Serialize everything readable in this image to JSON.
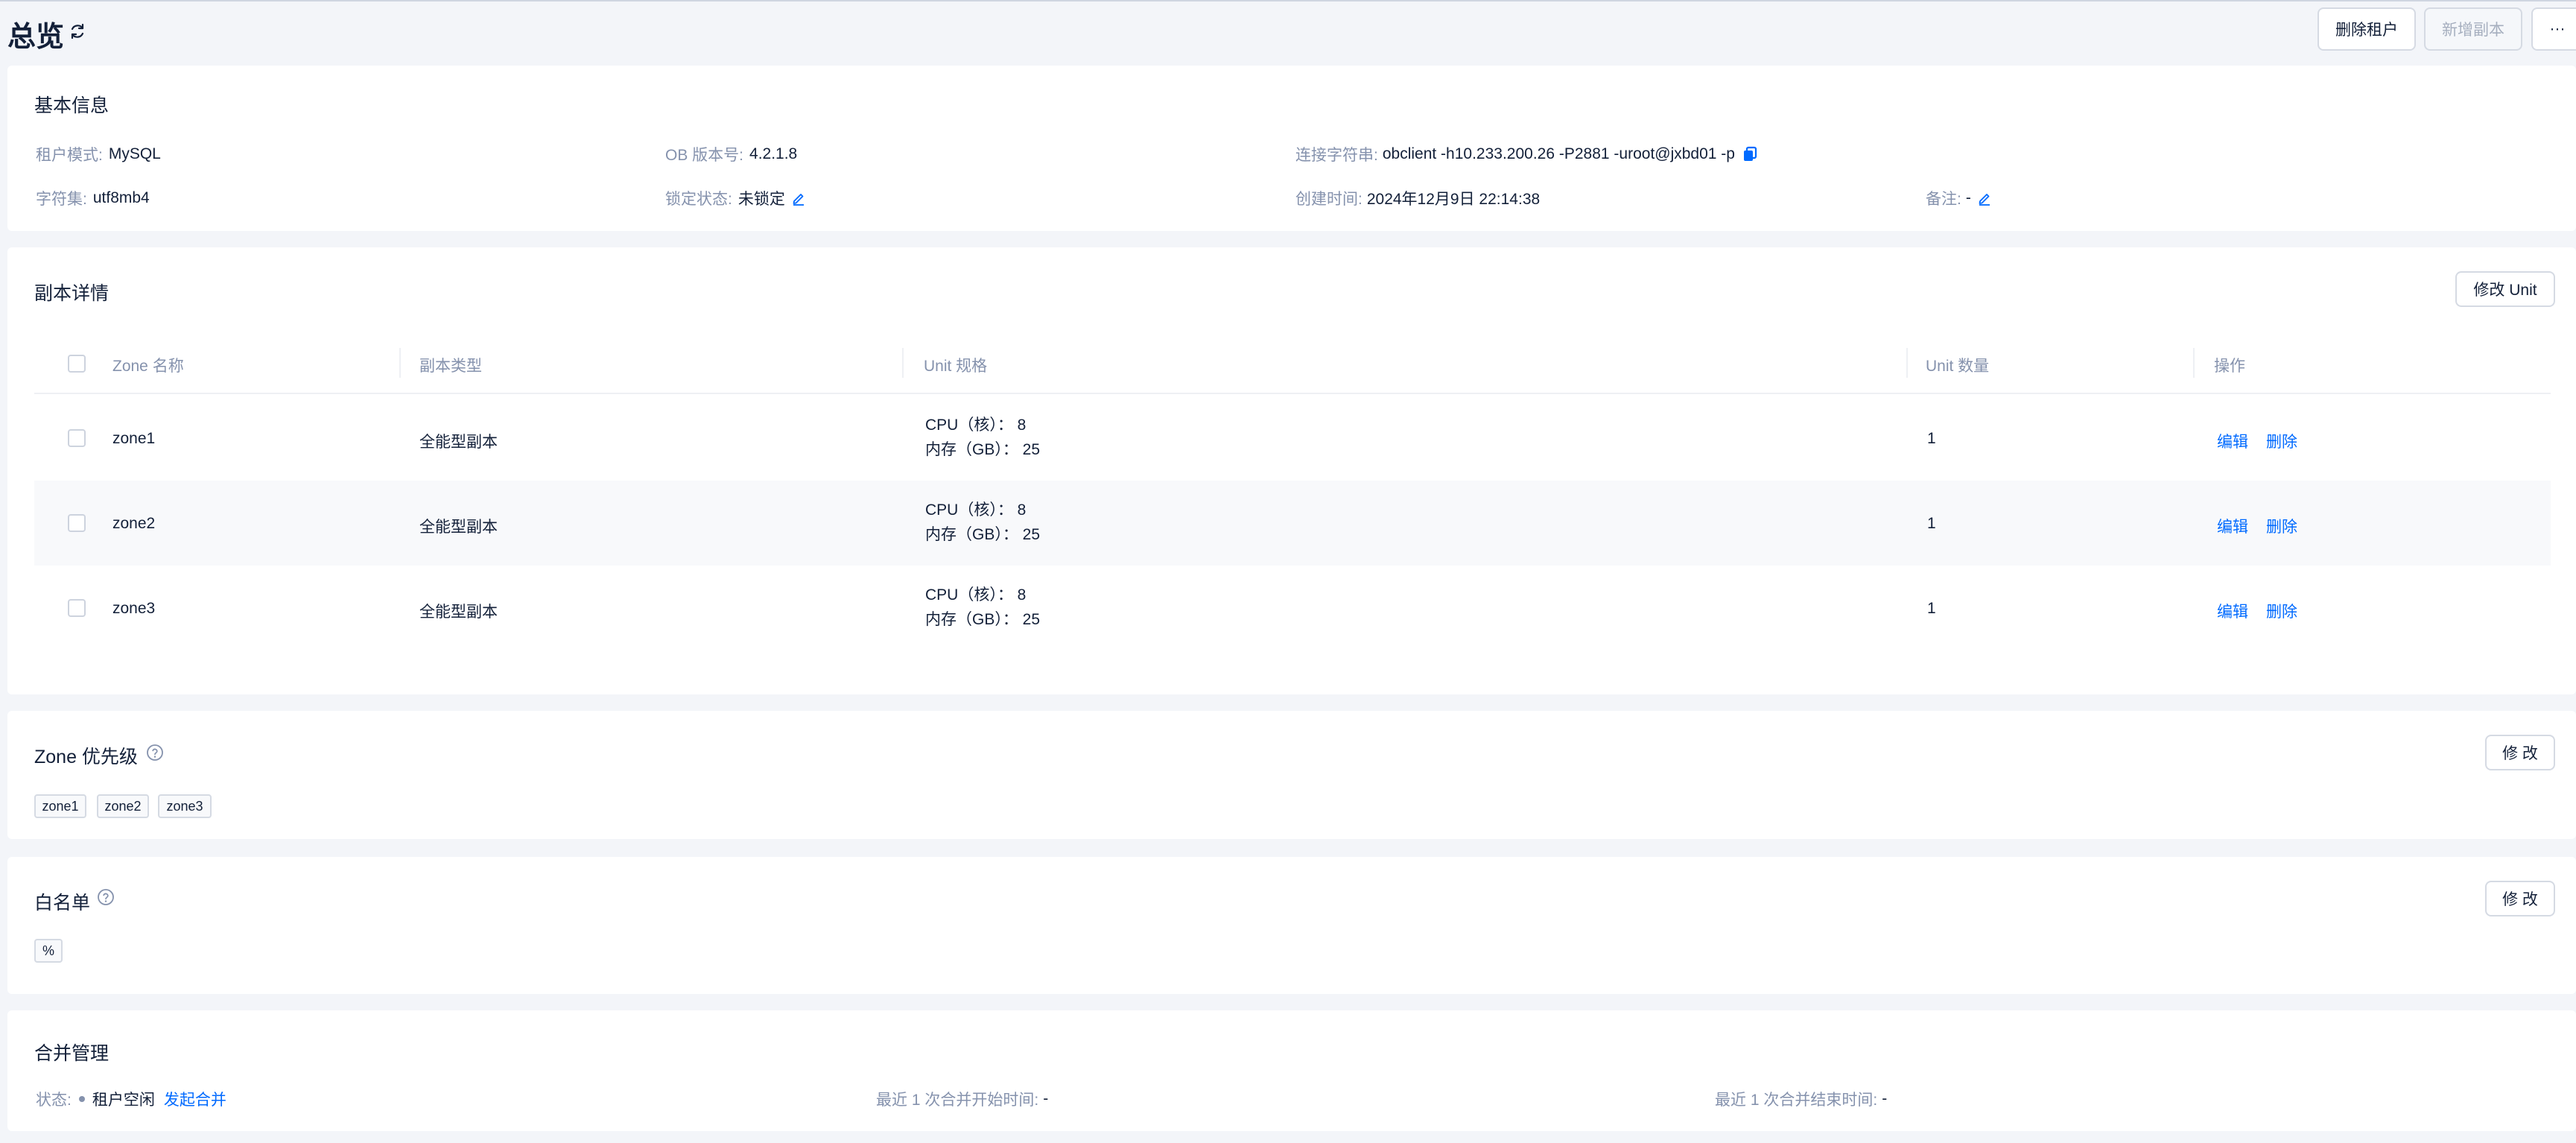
{
  "header": {
    "title": "总览",
    "delete_tenant_label": "删除租户",
    "add_replica_label": "新增副本",
    "more_label": "···"
  },
  "basic_info": {
    "title": "基本信息",
    "tenant_mode_label": "租户模式:",
    "tenant_mode_value": "MySQL",
    "ob_version_label": "OB 版本号:",
    "ob_version_value": "4.2.1.8",
    "conn_string_label": "连接字符串:",
    "conn_string_value": "obclient -h10.233.200.26 -P2881 -uroot@jxbd01 -p",
    "charset_label": "字符集:",
    "charset_value": "utf8mb4",
    "lock_status_label": "锁定状态:",
    "lock_status_value": "未锁定",
    "created_label": "创建时间:",
    "created_value": "2024年12月9日 22:14:38",
    "remark_label": "备注:",
    "remark_value": "-"
  },
  "replicas": {
    "title": "副本详情",
    "modify_unit_label": "修改 Unit",
    "columns": {
      "zone": "Zone 名称",
      "type": "副本类型",
      "unit_spec": "Unit 规格",
      "unit_count": "Unit 数量",
      "actions": "操作"
    },
    "rows": [
      {
        "zone": "zone1",
        "type": "全能型副本",
        "cpu": "CPU（核）： 8",
        "mem": "内存（GB）： 25",
        "count": "1",
        "edit": "编辑",
        "delete": "删除"
      },
      {
        "zone": "zone2",
        "type": "全能型副本",
        "cpu": "CPU（核）： 8",
        "mem": "内存（GB）： 25",
        "count": "1",
        "edit": "编辑",
        "delete": "删除"
      },
      {
        "zone": "zone3",
        "type": "全能型副本",
        "cpu": "CPU（核）： 8",
        "mem": "内存（GB）： 25",
        "count": "1",
        "edit": "编辑",
        "delete": "删除"
      }
    ]
  },
  "zone_priority": {
    "title": "Zone 优先级",
    "modify_label": "修 改",
    "tags": [
      "zone1",
      "zone2",
      "zone3"
    ]
  },
  "whitelist": {
    "title": "白名单",
    "modify_label": "修 改",
    "tags": [
      "%"
    ]
  },
  "merge": {
    "title": "合并管理",
    "status_label": "状态:",
    "status_value": "租户空闲",
    "start_merge_label": "发起合并",
    "last_start_label": "最近 1 次合并开始时间:",
    "last_start_value": "-",
    "last_end_label": "最近 1 次合并结束时间:",
    "last_end_value": "-"
  },
  "colors": {
    "accent": "#006aff",
    "muted_text": "#8592ad",
    "text": "#132039",
    "background": "#f3f5f9"
  }
}
